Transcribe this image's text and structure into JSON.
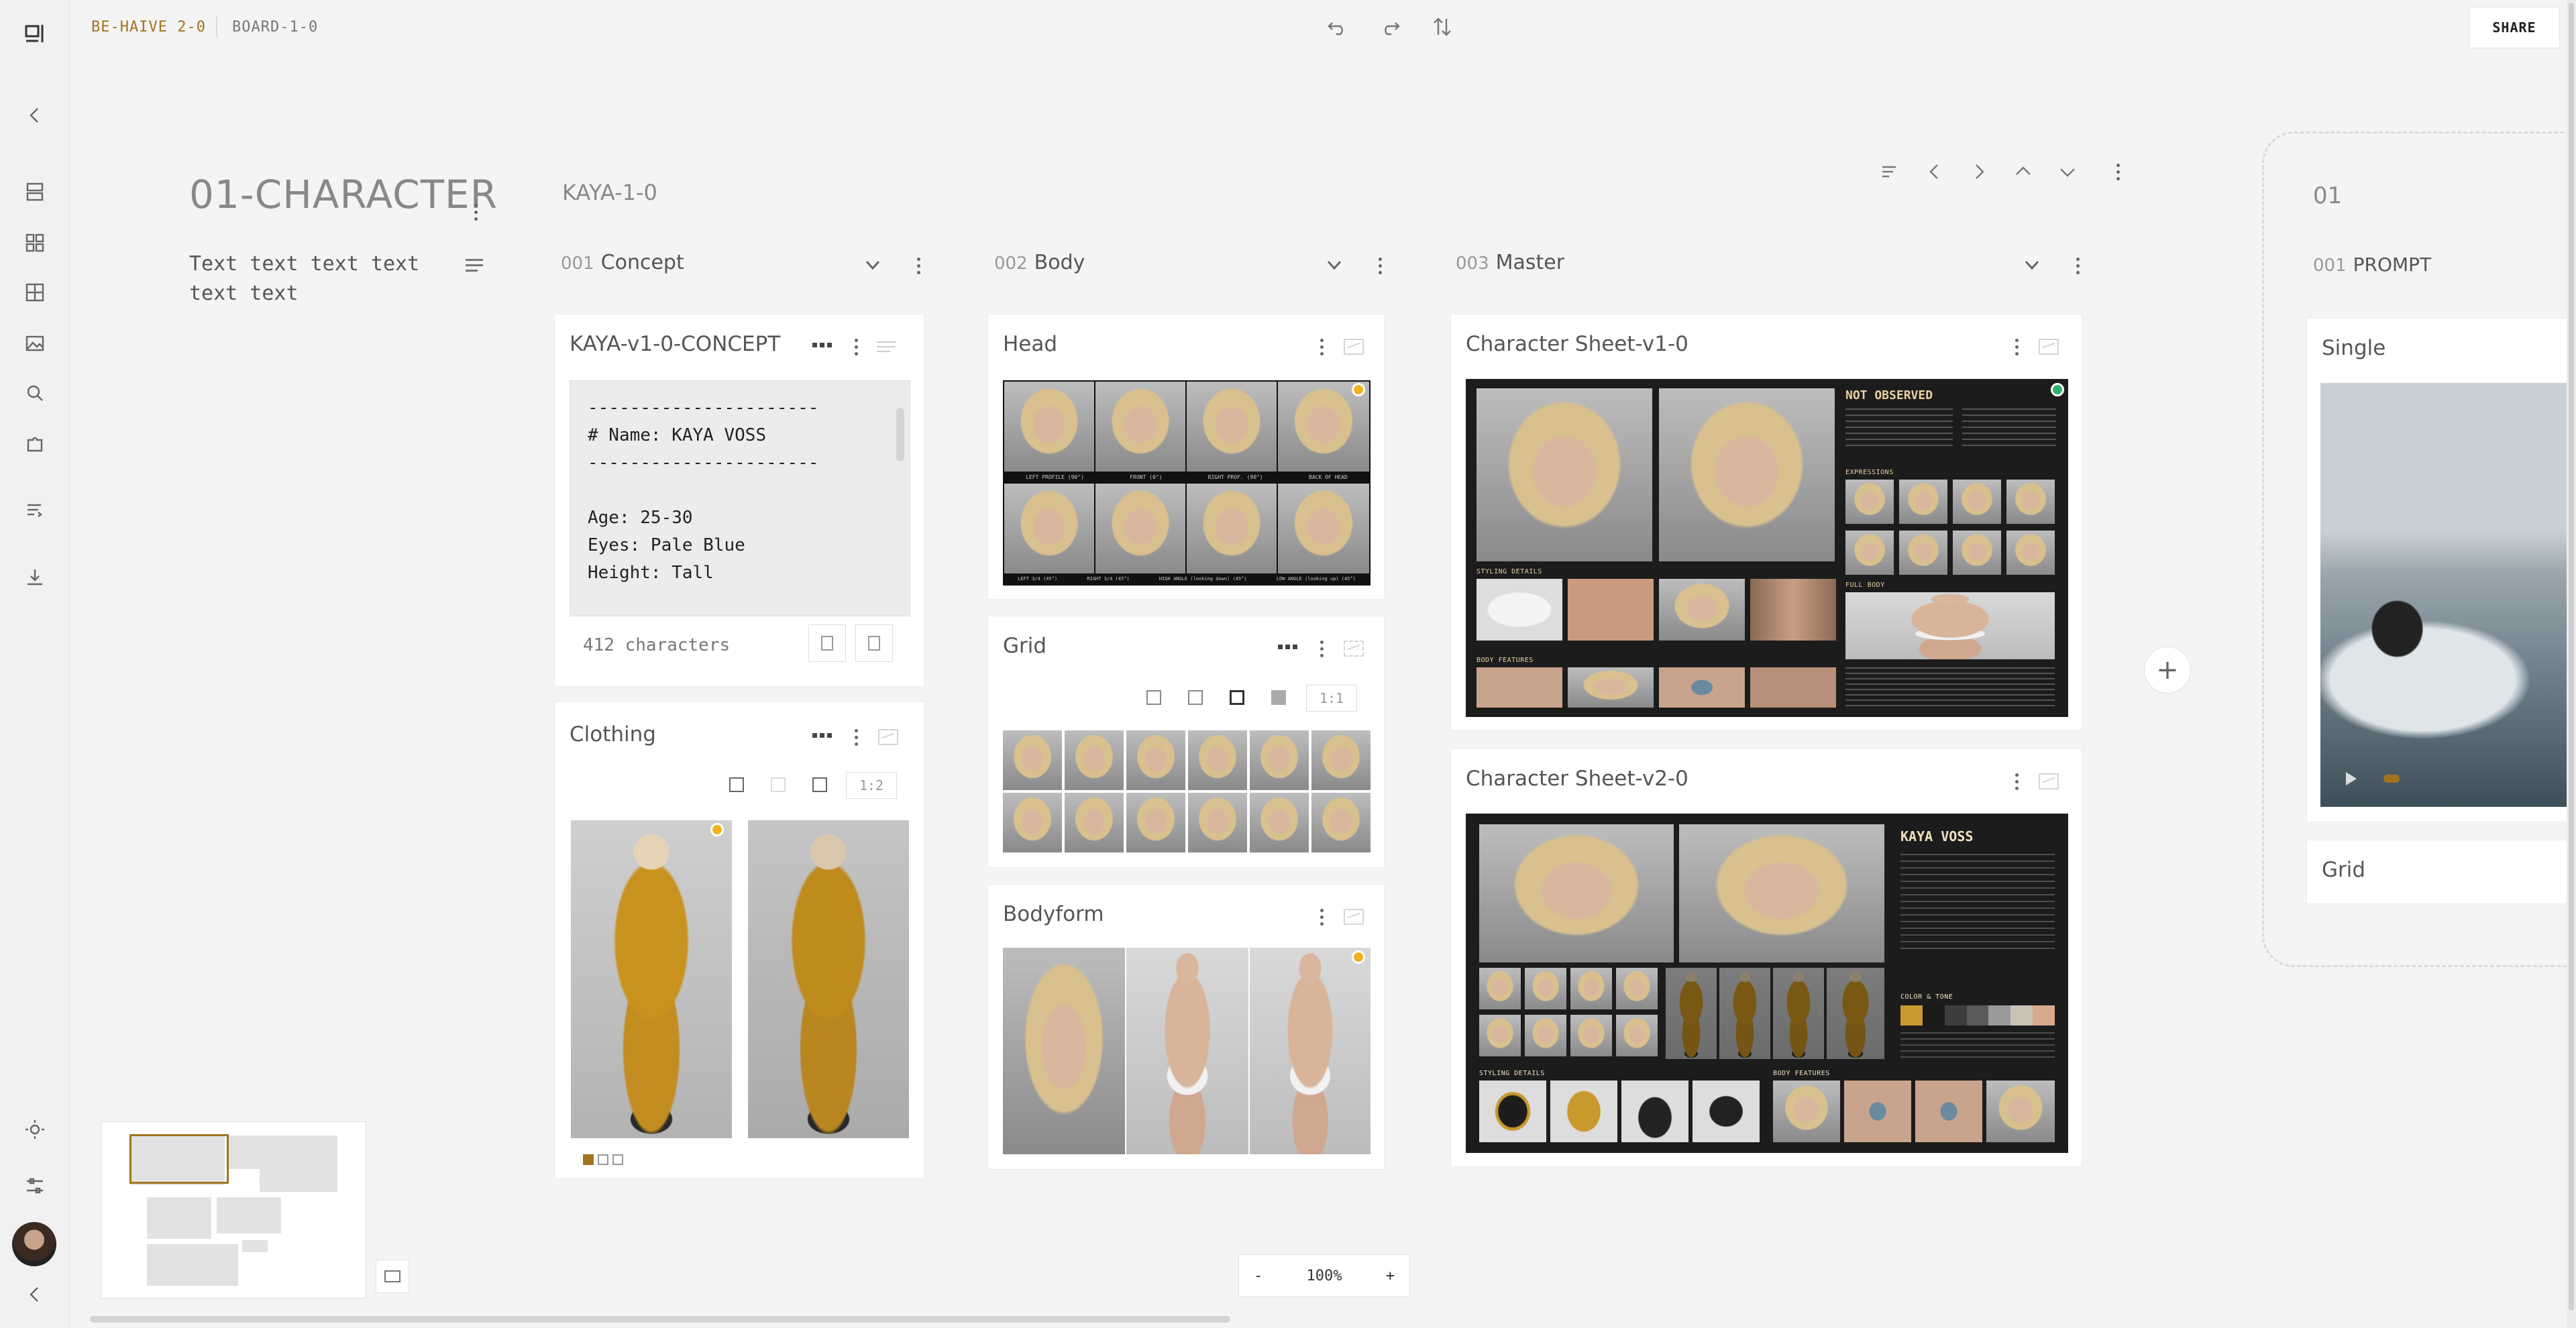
{
  "header": {
    "project": "BE-HAIVE 2-0",
    "board": "BOARD-1-0",
    "share_label": "SHARE"
  },
  "left_panel": {
    "title": "01-CHARACTER",
    "description": "Text text text text text text"
  },
  "board": {
    "title": "KAYA-1-0"
  },
  "columns": [
    {
      "num": "001",
      "name": "Concept"
    },
    {
      "num": "002",
      "name": "Body"
    },
    {
      "num": "003",
      "name": "Master"
    }
  ],
  "concept_card": {
    "title": "KAYA-v1-0-CONCEPT",
    "lines": [
      "----------------------",
      "# Name: KAYA VOSS",
      "----------------------",
      "",
      "Age: 25-30",
      "Eyes: Pale Blue",
      "Height: Tall",
      "",
      "----------------------"
    ],
    "char_count": "412 characters"
  },
  "clothing_card": {
    "title": "Clothing",
    "ratio": "1:2"
  },
  "head_card": {
    "title": "Head",
    "labels_top": [
      "LEFT PROFILE (90°)",
      "FRONT (0°)",
      "RIGHT PROF. (90°)",
      "BACK OF HEAD"
    ],
    "labels_bottom": [
      "LEFT 3/4 (45°)",
      "RIGHT 3/4 (45°)",
      "HIGH ANGLE (looking down) (45°)",
      "LOW ANGLE (looking up) (45°)"
    ]
  },
  "grid_card": {
    "title": "Grid",
    "ratio": "1:1"
  },
  "bodyform_card": {
    "title": "Bodyform"
  },
  "sheet1": {
    "title": "Character Sheet-v1-0",
    "heading": "NOT OBSERVED",
    "sections": [
      "EXPRESSIONS",
      "FULL BODY",
      "STYLING DETAILS",
      "BODY FEATURES"
    ]
  },
  "sheet2": {
    "title": "Character Sheet-v2-0",
    "heading": "KAYA VOSS",
    "sections": [
      "COLOR & TONE",
      "STYLING DETAILS",
      "BODY FEATURES"
    ],
    "palette": [
      "#c89a2e",
      "#1a1a1a",
      "#3d3d3d",
      "#5a5a5a",
      "#9a9a9a",
      "#c9c2b5",
      "#d8a98c"
    ]
  },
  "right_group": {
    "title": "01",
    "column": {
      "num": "001",
      "name": "PROMPT"
    },
    "cards": [
      "Single",
      "Grid"
    ]
  },
  "zoom": {
    "minus": "-",
    "value": "100%",
    "plus": "+"
  },
  "colors": {
    "accent": "#a0741e",
    "status_yellow": "#f2b21f",
    "status_green": "#2fb36b",
    "avatar": "#3a2a22"
  }
}
